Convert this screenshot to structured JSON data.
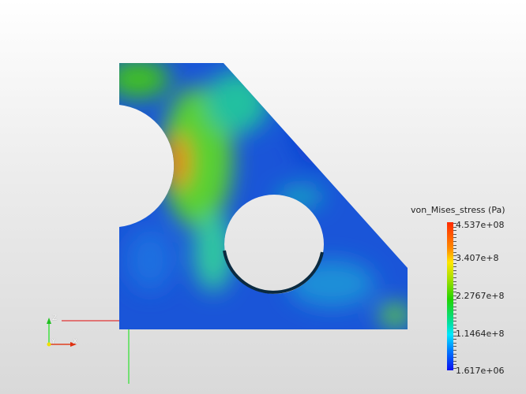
{
  "colorbar": {
    "title": "von_Mises_stress (Pa)",
    "labels": [
      "4.537e+08",
      "3.407e+8",
      "2.2767e+8",
      "1.1464e+8",
      "1.617e+06"
    ],
    "range": [
      1617000,
      453700000
    ]
  },
  "axes": {
    "z": "Z",
    "y": "Y",
    "x": "X"
  }
}
